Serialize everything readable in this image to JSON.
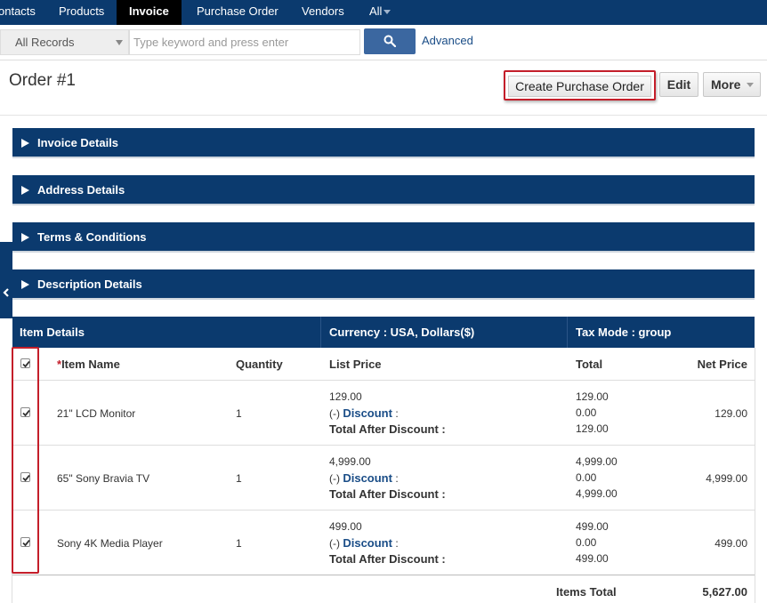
{
  "nav": {
    "items": [
      {
        "label": "ontacts"
      },
      {
        "label": "Products"
      },
      {
        "label": "Invoice"
      },
      {
        "label": "Purchase Order"
      },
      {
        "label": "Vendors"
      },
      {
        "label": "All"
      }
    ]
  },
  "search": {
    "records_select": "All Records",
    "placeholder": "Type keyword and press enter",
    "advanced_label": "Advanced"
  },
  "header": {
    "title": "Order #1",
    "create_po_label": "Create Purchase Order",
    "edit_label": "Edit",
    "more_label": "More"
  },
  "sections": [
    {
      "label": "Invoice Details"
    },
    {
      "label": "Address Details"
    },
    {
      "label": "Terms & Conditions"
    },
    {
      "label": "Description Details"
    }
  ],
  "items_header": {
    "item_details": "Item Details",
    "currency": "Currency : USA, Dollars($)",
    "tax_mode": "Tax Mode : group"
  },
  "columns": {
    "required_mark": "*",
    "item_name": "Item Name",
    "quantity": "Quantity",
    "list_price": "List Price",
    "total": "Total",
    "net_price": "Net Price"
  },
  "labels": {
    "discount_prefix": "(-)",
    "discount": "Discount",
    "colon": ":",
    "total_after_discount": "Total After Discount :"
  },
  "items": [
    {
      "name": "21\" LCD Monitor",
      "quantity": "1",
      "list_price": "129.00",
      "total": "129.00",
      "discount": "0.00",
      "total_after_discount": "129.00",
      "net_price": "129.00",
      "checked": true
    },
    {
      "name": "65\" Sony Bravia TV",
      "quantity": "1",
      "list_price": "4,999.00",
      "total": "4,999.00",
      "discount": "0.00",
      "total_after_discount": "4,999.00",
      "net_price": "4,999.00",
      "checked": true
    },
    {
      "name": "Sony 4K Media Player",
      "quantity": "1",
      "list_price": "499.00",
      "total": "499.00",
      "discount": "0.00",
      "total_after_discount": "499.00",
      "net_price": "499.00",
      "checked": true
    }
  ],
  "footer": {
    "items_total_label": "Items Total",
    "items_total_value": "5,627.00"
  },
  "colors": {
    "nav_bg": "#0b3a6e",
    "accent": "#3b67a0",
    "highlight": "#c41e2a"
  }
}
